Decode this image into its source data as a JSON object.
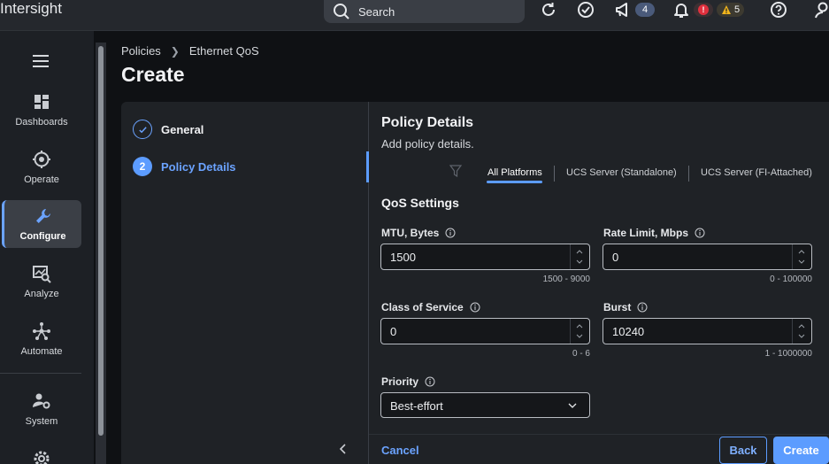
{
  "app": {
    "brand": "Intersight"
  },
  "topbar": {
    "search_placeholder": "Search",
    "announcements_count": "4",
    "critical_count": "!",
    "warnings_count": "5"
  },
  "nav": {
    "items": [
      {
        "label": "Dashboards",
        "icon": "dashboard-icon"
      },
      {
        "label": "Operate",
        "icon": "operate-icon"
      },
      {
        "label": "Configure",
        "icon": "wrench-icon",
        "active": true
      },
      {
        "label": "Analyze",
        "icon": "analyze-icon"
      },
      {
        "label": "Automate",
        "icon": "automate-icon"
      },
      {
        "label": "System",
        "icon": "system-icon"
      }
    ]
  },
  "breadcrumb": {
    "root": "Policies",
    "current": "Ethernet QoS"
  },
  "page": {
    "title": "Create"
  },
  "wizard": {
    "steps": [
      {
        "label": "General",
        "state": "done"
      },
      {
        "number": "2",
        "label": "Policy Details",
        "state": "current"
      }
    ]
  },
  "details": {
    "title": "Policy Details",
    "subtitle": "Add policy details.",
    "platform_tabs": [
      "All Platforms",
      "UCS Server (Standalone)",
      "UCS Server (FI-Attached)"
    ],
    "qos_title": "QoS Settings",
    "fields": {
      "mtu": {
        "label": "MTU, Bytes",
        "value": "1500",
        "range": "1500 - 9000"
      },
      "rate_limit": {
        "label": "Rate Limit, Mbps",
        "value": "0",
        "range": "0 - 100000"
      },
      "cos": {
        "label": "Class of Service",
        "value": "0",
        "range": "0 - 6"
      },
      "burst": {
        "label": "Burst",
        "value": "10240",
        "range": "1 - 1000000"
      },
      "priority": {
        "label": "Priority",
        "value": "Best-effort"
      }
    }
  },
  "footer": {
    "cancel": "Cancel",
    "back": "Back",
    "create": "Create"
  },
  "colors": {
    "accent": "#5c9cff",
    "critical": "#e0303e",
    "warning": "#f2b51c"
  }
}
